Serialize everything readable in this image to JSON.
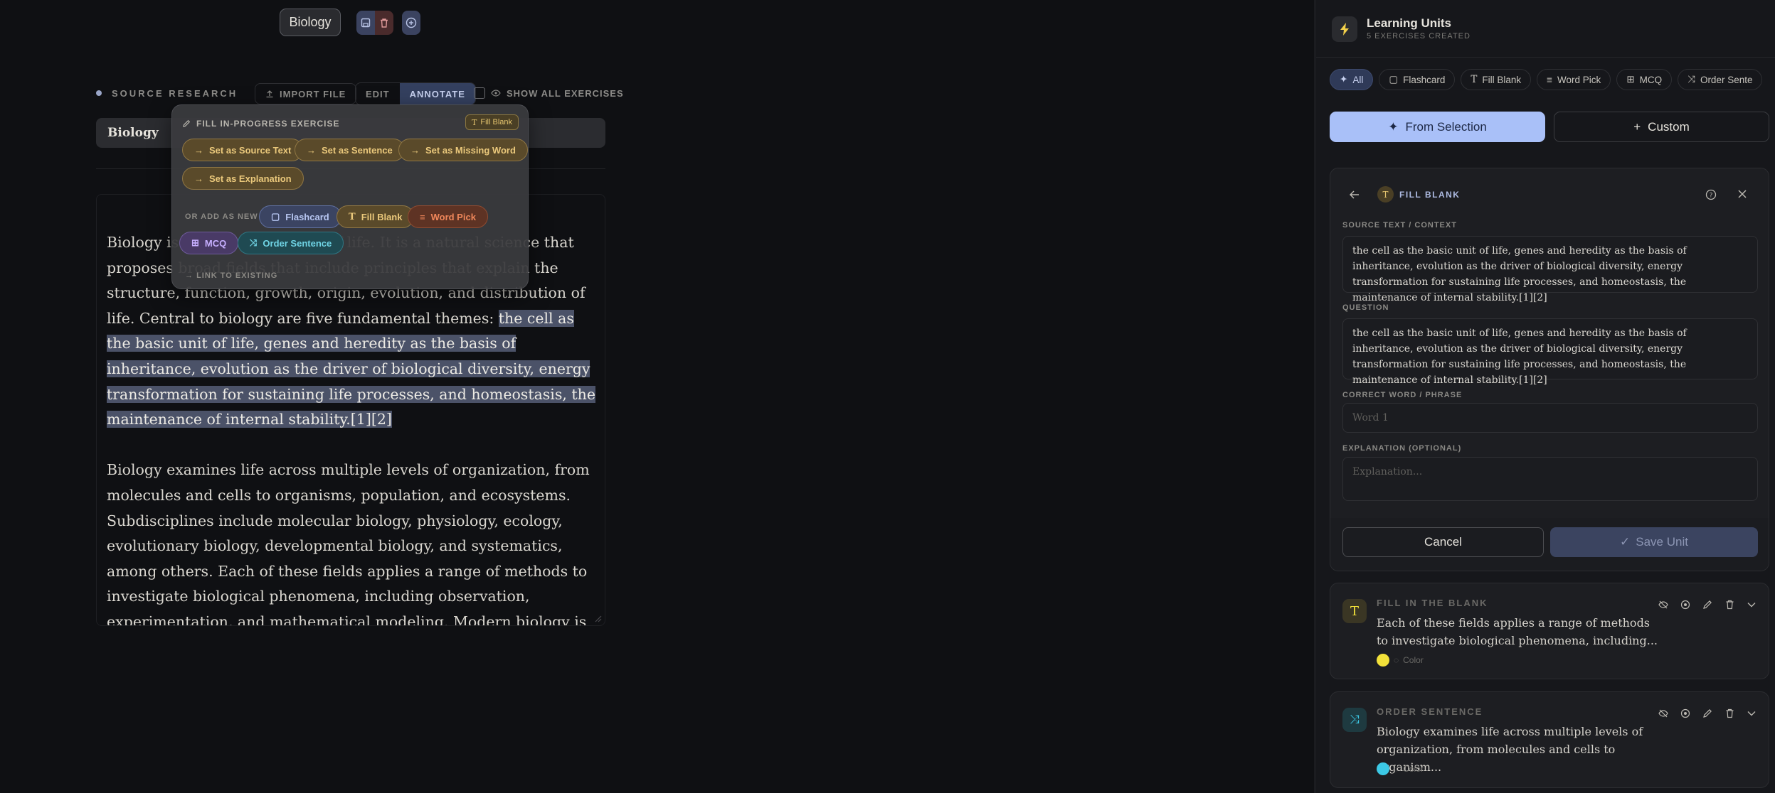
{
  "toolbar": {
    "topic_chip": "Biology",
    "icons": [
      "save-icon",
      "trash-icon",
      "plus-circle-icon"
    ]
  },
  "source_bar": {
    "label": "SOURCE RESEARCH",
    "import": "IMPORT FILE",
    "modes": [
      "EDIT",
      "ANNOTATE"
    ],
    "active_mode": "ANNOTATE",
    "show_all": "SHOW ALL EXERCISES",
    "topic_value": "Biology"
  },
  "document": {
    "p1_pre": "Biology is the scientific study of life. It is a natural science that proposes broad fields that include principles that explain the structure, function, growth, origin, evolution, and distribution of life. Central to biology are five fundamental themes: ",
    "p1_highlight": "the cell as the basic unit of life, genes and heredity as the basis of inheritance, evolution as the driver of biological diversity, energy transformation for sustaining life processes, and homeostasis, the maintenance of internal stability.[1][2]",
    "p2": "Biology examines life across multiple levels of organization, from molecules and cells to organisms, population, and ecosystems. Subdisciplines include molecular biology, physiology, ecology, evolutionary biology, developmental biology, and systematics, among others. Each of these fields applies a range of methods to investigate biological phenomena, including observation, experimentation, and mathematical modeling. Modern biology is grounded in the theory of evolution by natural selection, first articulated by Charles Darwin, and in the molecular understanding of genes encoded in DNA. The"
  },
  "popup": {
    "header": "FILL IN-PROGRESS EXERCISE",
    "tag": "Fill Blank",
    "actions": [
      "Set as Source Text",
      "Set as Sentence",
      "Set as Missing Word",
      "Set as Explanation"
    ],
    "or_label": "OR ADD AS NEW",
    "new_types": [
      "Flashcard",
      "Fill Blank",
      "Word Pick",
      "MCQ",
      "Order Sentence"
    ],
    "link_label": "LINK TO EXISTING"
  },
  "panel": {
    "title": "Learning Units",
    "subtitle": "5 EXERCISES CREATED",
    "filters": [
      "All",
      "Flashcard",
      "Fill Blank",
      "Word Pick",
      "MCQ",
      "Order Sente"
    ],
    "from_selection": "From Selection",
    "custom": "Custom"
  },
  "editor": {
    "title": "FILL BLANK",
    "source_label": "SOURCE TEXT / CONTEXT",
    "source_value": "the cell as the basic unit of life, genes and heredity as the basis of inheritance, evolution as the driver of biological diversity, energy transformation for sustaining life processes, and homeostasis, the maintenance of internal stability.[1][2]",
    "question_label": "QUESTION",
    "question_value": "the cell as the basic unit of life, genes and heredity as the basis of inheritance, evolution as the driver of biological diversity, energy transformation for sustaining life processes, and homeostasis, the maintenance of internal stability.[1][2]",
    "correct_label": "CORRECT WORD / PHRASE",
    "correct_placeholder": "Word 1",
    "explanation_label": "EXPLANATION (OPTIONAL)",
    "explanation_placeholder": "Explanation...",
    "cancel": "Cancel",
    "save": "Save Unit"
  },
  "units": [
    {
      "type": "FILL IN THE BLANK",
      "text": "Each of these fields applies a range of methods to investigate biological phenomena, including...",
      "color_label": "Color",
      "color": "#f2e13a",
      "icon": "text-t-icon"
    },
    {
      "type": "ORDER SENTENCE",
      "text": "Biology examines life across multiple levels of organization, from molecules and cells to organism...",
      "color_label": "Color",
      "color": "#3cc9e6",
      "icon": "shuffle-icon"
    }
  ],
  "colors": {
    "accent": "#a9c0f8",
    "highlight": "#4b5268",
    "gold": "#eac87b",
    "orange": "#f0875a",
    "purple": "#c6afff",
    "teal": "#6fd3e4"
  }
}
